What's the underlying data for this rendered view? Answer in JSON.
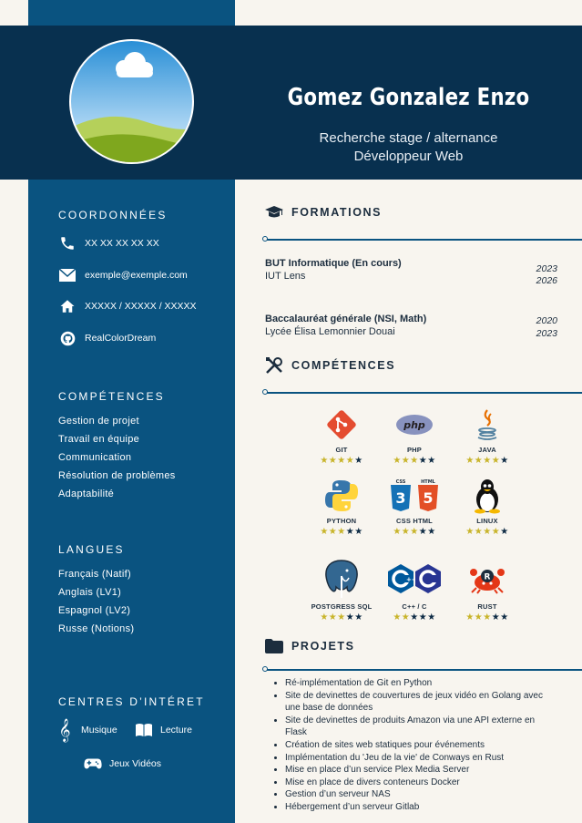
{
  "header": {
    "name": "Gomez Gonzalez Enzo",
    "subtitle_line1": "Recherche stage / alternance",
    "subtitle_line2": "Développeur Web"
  },
  "sidebar": {
    "contact_title": "COORDONNÉES",
    "contacts": [
      {
        "icon": "phone-icon",
        "text": "XX XX XX XX XX"
      },
      {
        "icon": "mail-icon",
        "text": "exemple@exemple.com"
      },
      {
        "icon": "home-icon",
        "text": "XXXXX / XXXXX / XXXXX"
      },
      {
        "icon": "github-icon",
        "text": "RealColorDream"
      }
    ],
    "skills_title": "COMPÉTENCES",
    "skills": [
      "Gestion de projet",
      "Travail en équipe",
      "Communication",
      "Résolution de problèmes",
      "Adaptabilité"
    ],
    "languages_title": "LANGUES",
    "languages": [
      "Français (Natif)",
      "Anglais (LV1)",
      "Espagnol (LV2)",
      "Russe (Notions)"
    ],
    "interests_title": "CENTRES D’INTÉRET",
    "interests": [
      {
        "icon": "music-icon",
        "text": "Musique"
      },
      {
        "icon": "book-icon",
        "text": "Lecture"
      },
      {
        "icon": "gamepad-icon",
        "text": "Jeux Vidéos"
      }
    ]
  },
  "formations": {
    "title": "FORMATIONS",
    "items": [
      {
        "title": "BUT Informatique (En cours)",
        "school": "IUT Lens",
        "start": "2023",
        "end": "2026"
      },
      {
        "title": "Baccalauréat générale (NSI, Math)",
        "school": "Lycée Élisa Lemonnier Douai",
        "start": "2020",
        "end": "2023"
      }
    ]
  },
  "competences": {
    "title": "COMPÉTENCES",
    "items": [
      {
        "label": "GIT",
        "rating": 4,
        "max": 5
      },
      {
        "label": "PHP",
        "rating": 3,
        "max": 5
      },
      {
        "label": "JAVA",
        "rating": 4,
        "max": 5
      },
      {
        "label": "PYTHON",
        "rating": 3,
        "max": 5
      },
      {
        "label": "CSS HTML",
        "rating": 3,
        "max": 5
      },
      {
        "label": "LINUX",
        "rating": 4,
        "max": 5
      },
      {
        "label": "POSTGRESS SQL",
        "rating": 3,
        "max": 5
      },
      {
        "label": "C++ / C",
        "rating": 2,
        "max": 5
      },
      {
        "label": "RUST",
        "rating": 3,
        "max": 5
      }
    ]
  },
  "projets": {
    "title": "PROJETS",
    "items": [
      "Ré-implémentation de Git en Python",
      "Site de devinettes de couvertures de jeux vidéo en Golang avec une base de données",
      "Site de devinettes de produits Amazon via une API externe en Flask",
      "Création de sites web statiques pour événements",
      "Implémentation du 'Jeu de la vie' de Conways en Rust",
      "Mise en place d’un service Plex Media Server",
      "Mise en place de divers conteneurs Docker",
      "Gestion d’un serveur NAS",
      "Hébergement d’un serveur Gitlab"
    ]
  },
  "colors": {
    "sidebar": "#0a5380",
    "header": "#08304f",
    "background": "#f8f5ef",
    "star_filled": "#c8b42a",
    "star_empty": "#0d2a44"
  }
}
